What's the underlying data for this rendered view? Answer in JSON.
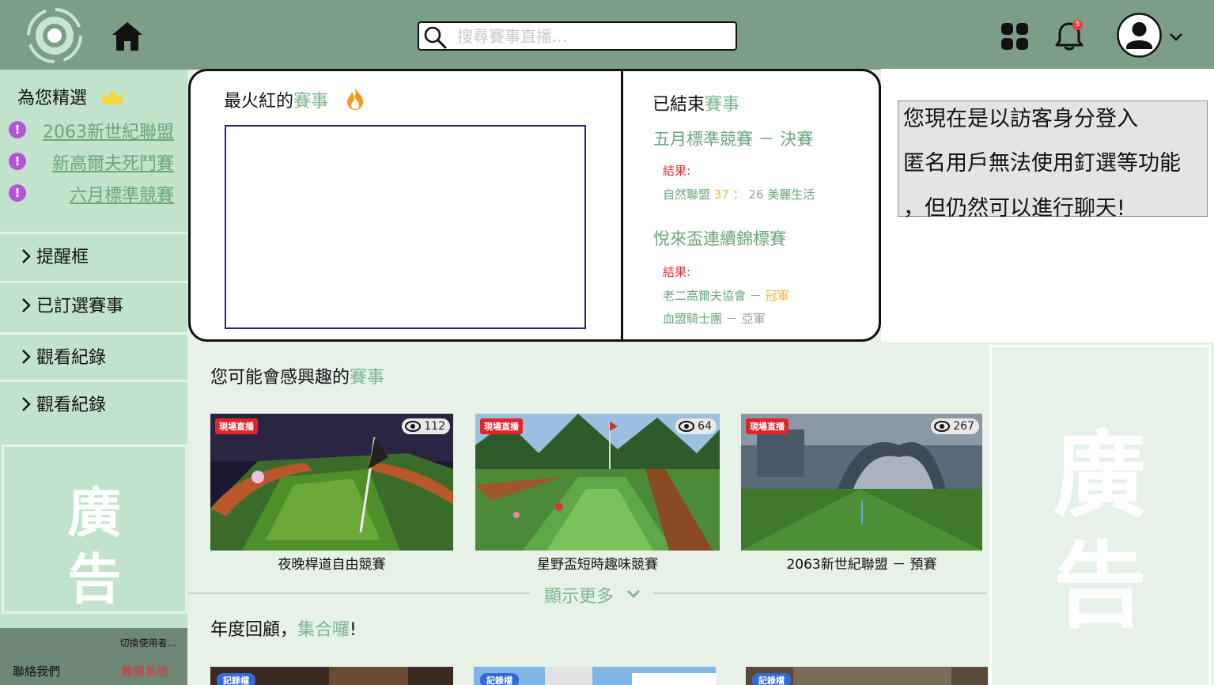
{
  "header": {
    "logo_icon": "target-logo-icon",
    "home_icon": "home-icon",
    "search": {
      "placeholder": "搜尋賽事直播...",
      "value": "",
      "icon": "search-icon"
    },
    "apps_icon": "grid-apps-icon",
    "notifications": {
      "icon": "bell-icon",
      "count": "5"
    },
    "user_icon": "user-avatar-icon",
    "dropdown_icon": "chevron-down-icon"
  },
  "sidebar": {
    "picks_title": "為您精選",
    "picks_icon": "crown-icon",
    "picks": [
      {
        "label": "2063新世紀聯盟",
        "badge": "!"
      },
      {
        "label": "新高爾夫死鬥賽",
        "badge": "!"
      },
      {
        "label": "六月標準競賽",
        "badge": "!"
      }
    ],
    "menu": [
      {
        "label": "提醒框"
      },
      {
        "label": "已訂選賽事"
      },
      {
        "label": "觀看紀錄"
      },
      {
        "label": "觀看紀錄"
      }
    ],
    "ad": {
      "line1": "廣",
      "line2": "告"
    },
    "footer": {
      "switch_user": "切換使用者...",
      "contact": "聯絡我們",
      "logout": "離開系統"
    }
  },
  "hot": {
    "title_prefix": "最火紅的",
    "title_highlight": "賽事",
    "icon": "flame-icon"
  },
  "ended": {
    "title_prefix": "已結束",
    "title_highlight": "賽事",
    "matches": [
      {
        "name": "五月標準競賽 － 決賽",
        "result_label": "結果:",
        "team_a": "自然聯盟",
        "score_a": "37",
        "sep": "：",
        "score_b": "26",
        "team_b": "美麗生活"
      },
      {
        "name": "悅來盃連續錦標賽",
        "result_label": "結果:",
        "first_team": "老二高爾夫協會",
        "first_dash": "－",
        "first_place": "冠軍",
        "second_team": "血盟騎士團",
        "second_dash": "－",
        "second_place": "亞軍"
      }
    ]
  },
  "notice": {
    "line1": "您現在是以訪客身分登入",
    "line2": "匿名用戶無法使用釘選等功能",
    "line3": "，但仍然可以進行聊天!"
  },
  "interest": {
    "title_prefix": "您可能會感興趣的",
    "title_highlight": "賽事",
    "cards": [
      {
        "badge": "現場直播",
        "views": "112",
        "title": "夜晚桿道自由競賽"
      },
      {
        "badge": "現場直播",
        "views": "64",
        "title": "星野盃短時趣味競賽"
      },
      {
        "badge": "現場直播",
        "views": "267",
        "title": "2063新世紀聯盟 － 預賽"
      }
    ],
    "more_label": "顯示更多"
  },
  "review": {
    "title_prefix": "年度回顧，",
    "title_highlight": "集合囉",
    "title_suffix": "!",
    "cards": [
      {
        "badge": "記錄檔"
      },
      {
        "badge": "記錄檔"
      },
      {
        "badge": "記錄檔"
      }
    ]
  },
  "right_ad": {
    "line1": "廣",
    "line2": "告"
  },
  "colors": {
    "header": "#7d9e86",
    "sidebar": "#c2e3cb",
    "accent_green": "#7fb88f",
    "live_red": "#e2242b",
    "record_blue": "#3469d8",
    "score_gold": "#f0b63c"
  }
}
